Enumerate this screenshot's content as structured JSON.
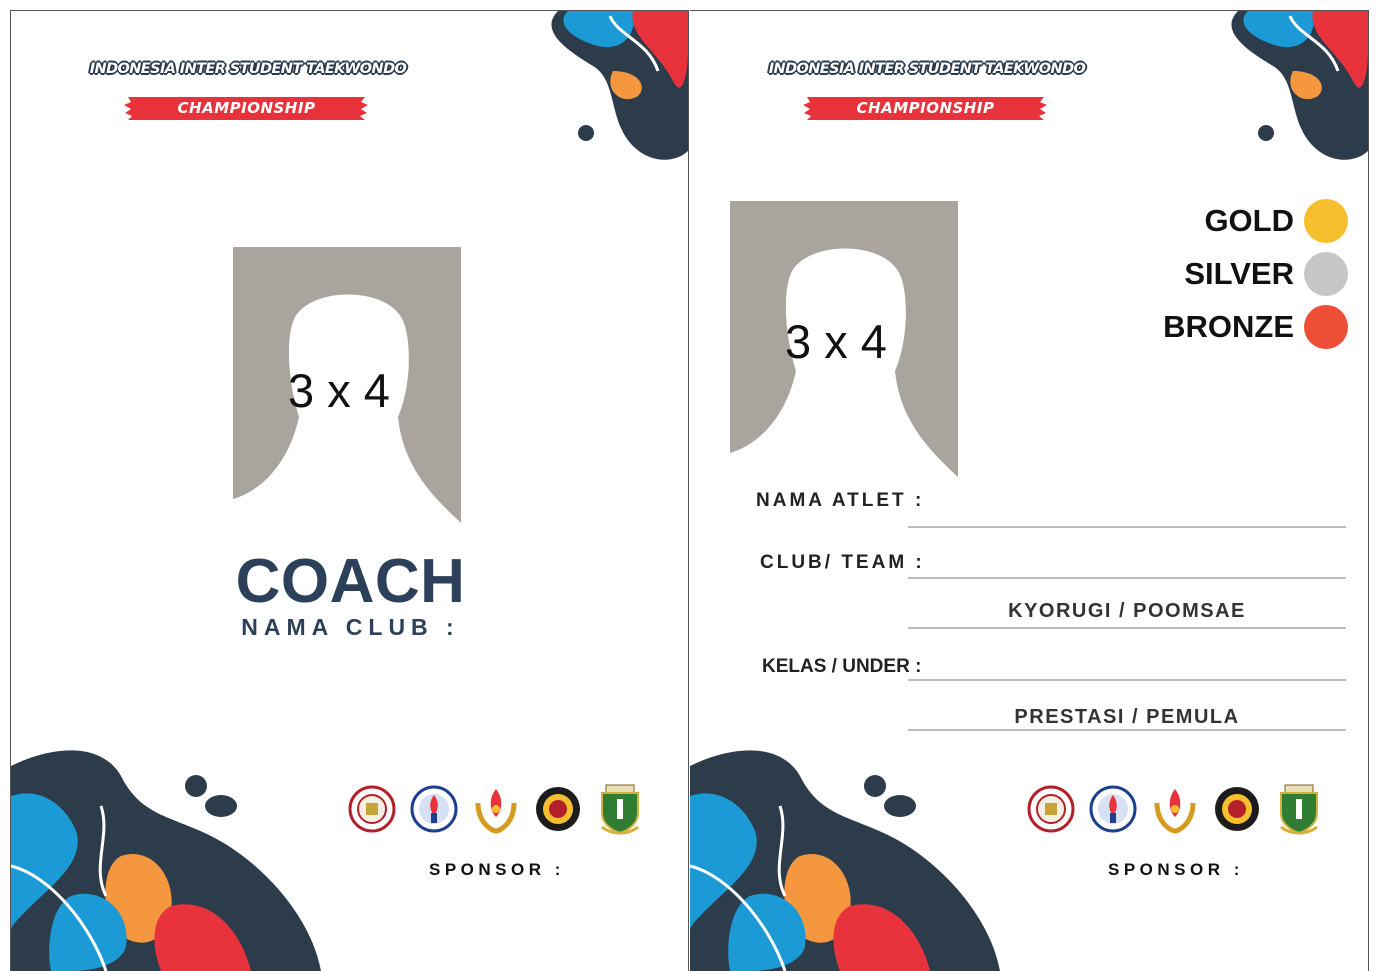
{
  "header": {
    "title_line": "INDONESIA INTER STUDENT TAEKWONDO",
    "banner": "CHAMPIONSHIP"
  },
  "coach_card": {
    "photo_label": "3 x 4",
    "role": "COACH",
    "club_label": "NAMA CLUB :",
    "sponsor_label": "SPONSOR :"
  },
  "athlete_card": {
    "photo_label": "3 x 4",
    "medals": [
      {
        "label": "GOLD",
        "color": "#f6bf2d"
      },
      {
        "label": "SILVER",
        "color": "#c7c7c7"
      },
      {
        "label": "BRONZE",
        "color": "#ef4f37"
      }
    ],
    "fields": {
      "athlete_name_label": "NAMA ATLET :",
      "club_team_label": "CLUB/ TEAM :",
      "category_value": "KYORUGI / POOMSAE",
      "class_label": "KELAS / UNDER :",
      "level_value": "PRESTASI / PEMULA"
    },
    "sponsor_label": "SPONSOR :"
  },
  "colors": {
    "navy": "#2c4159",
    "red": "#e8323c",
    "blue": "#1b9ad6",
    "orange": "#f5973f",
    "dark": "#2d3c4b",
    "photo_gray": "#aaa49f"
  },
  "logos": [
    "scroll-badge-logo",
    "ministry-torch-logo",
    "flame-wreath-logo",
    "federation-seal-logo",
    "provincial-shield-logo"
  ]
}
